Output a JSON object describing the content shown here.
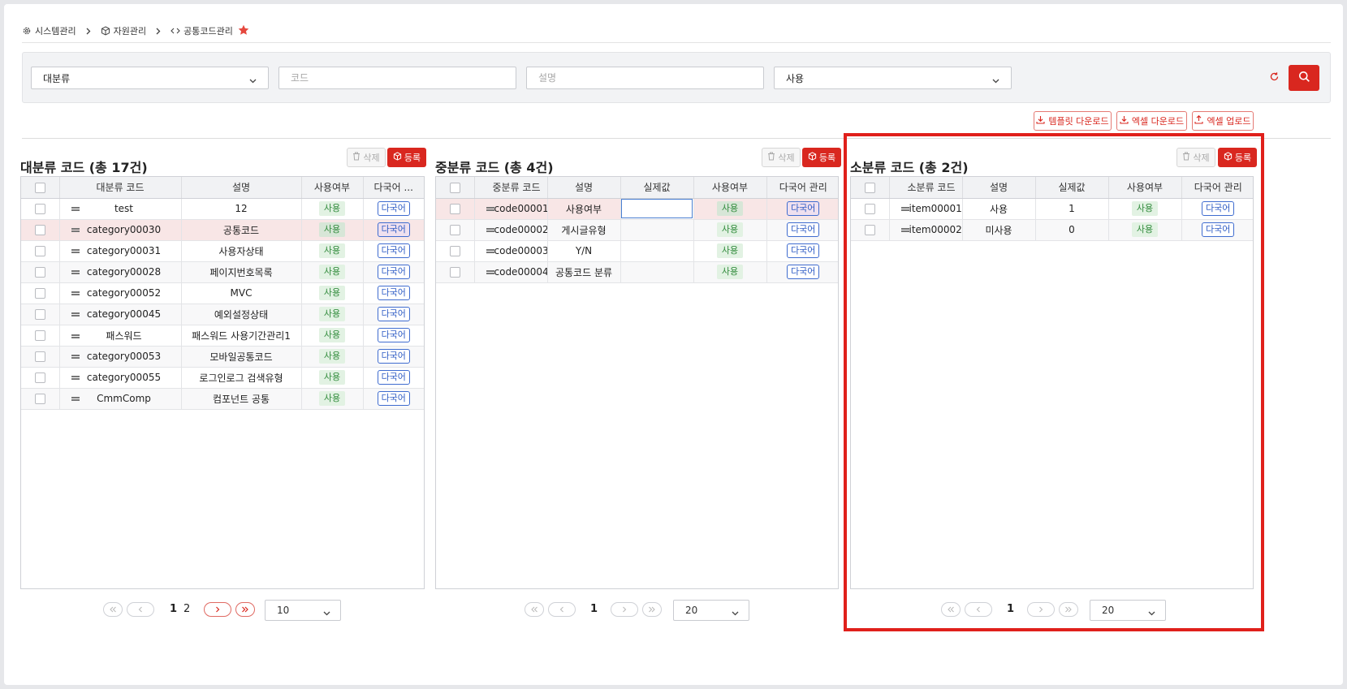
{
  "breadcrumb": {
    "items": [
      {
        "label": "시스템관리",
        "icon": "gear-icon"
      },
      {
        "label": "자원관리",
        "icon": "cube-icon"
      },
      {
        "label": "공통코드관리",
        "icon": "code-icon"
      }
    ]
  },
  "search": {
    "category_select": "대분류",
    "code_placeholder": "코드",
    "desc_placeholder": "설명",
    "use_select": "사용"
  },
  "actions": {
    "template_download": "템플릿 다운로드",
    "excel_download": "엑셀 다운로드",
    "excel_upload": "엑셀 업로드"
  },
  "panels": {
    "delete_label": "삭제",
    "register_label": "등록",
    "major": {
      "title": "대분류 코드 (총 17건)",
      "headers": [
        "대분류 코드",
        "설명",
        "사용여부",
        "다국어 ..."
      ],
      "rows": [
        {
          "code": "test",
          "desc": "12",
          "use": "사용",
          "lang": "다국어"
        },
        {
          "code": "category00030",
          "desc": "공통코드",
          "use": "사용",
          "lang": "다국어"
        },
        {
          "code": "category00031",
          "desc": "사용자상태",
          "use": "사용",
          "lang": "다국어"
        },
        {
          "code": "category00028",
          "desc": "페이지번호목록",
          "use": "사용",
          "lang": "다국어"
        },
        {
          "code": "category00052",
          "desc": "MVC",
          "use": "사용",
          "lang": "다국어"
        },
        {
          "code": "category00045",
          "desc": "예외설정상태",
          "use": "사용",
          "lang": "다국어"
        },
        {
          "code": "패스워드",
          "desc": "패스워드 사용기간관리1",
          "use": "사용",
          "lang": "다국어"
        },
        {
          "code": "category00053",
          "desc": "모바일공통코드",
          "use": "사용",
          "lang": "다국어"
        },
        {
          "code": "category00055",
          "desc": "로그인로그 검색유형",
          "use": "사용",
          "lang": "다국어"
        },
        {
          "code": "CmmComp",
          "desc": "컴포넌트 공통",
          "use": "사용",
          "lang": "다국어"
        }
      ],
      "pages": [
        "1",
        "2"
      ],
      "page_size": "10"
    },
    "middle": {
      "title": "중분류 코드 (총 4건)",
      "headers": [
        "중분류 코드",
        "설명",
        "실제값",
        "사용여부",
        "다국어 관리"
      ],
      "rows": [
        {
          "code": "code00001",
          "desc": "사용여부",
          "value": "",
          "use": "사용",
          "lang": "다국어"
        },
        {
          "code": "code00002",
          "desc": "게시글유형",
          "value": "",
          "use": "사용",
          "lang": "다국어"
        },
        {
          "code": "code00003",
          "desc": "Y/N",
          "value": "",
          "use": "사용",
          "lang": "다국어"
        },
        {
          "code": "code00004",
          "desc": "공통코드 분류",
          "value": "",
          "use": "사용",
          "lang": "다국어"
        }
      ],
      "pages": [
        "1"
      ],
      "page_size": "20"
    },
    "minor": {
      "title": "소분류 코드 (총 2건)",
      "headers": [
        "소분류 코드",
        "설명",
        "실제값",
        "사용여부",
        "다국어 관리"
      ],
      "rows": [
        {
          "code": "item00001",
          "desc": "사용",
          "value": "1",
          "use": "사용",
          "lang": "다국어"
        },
        {
          "code": "item00002",
          "desc": "미사용",
          "value": "0",
          "use": "사용",
          "lang": "다국어"
        }
      ],
      "pages": [
        "1"
      ],
      "page_size": "20"
    }
  },
  "colors": {
    "accent": "#d9271f",
    "highlight": "#e0201b",
    "link": "#2f5dc5",
    "use_badge": "#2f8a3a"
  }
}
